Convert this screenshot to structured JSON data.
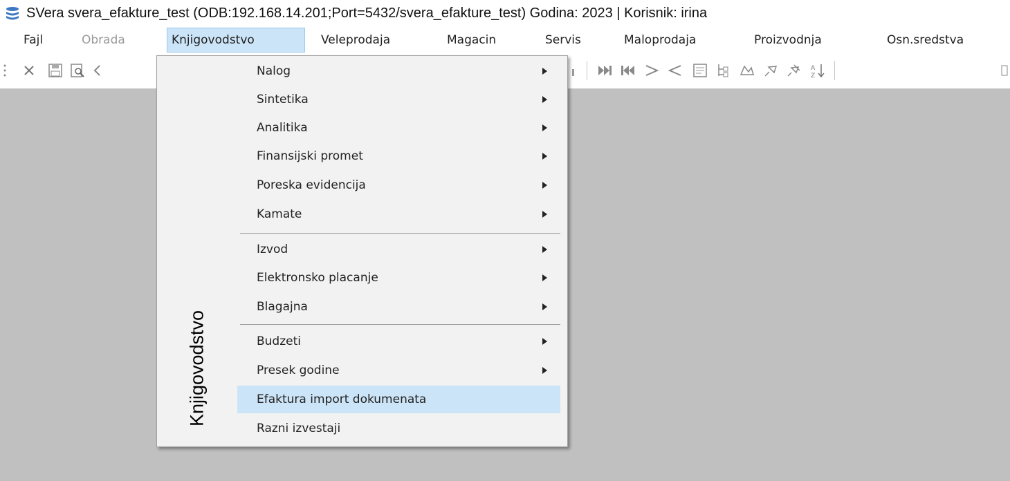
{
  "window": {
    "title": "SVera svera_efakture_test  (ODB:192.168.14.201;Port=5432/svera_efakture_test)  Godina: 2023 | Korisnik: irina"
  },
  "menubar": {
    "items": [
      {
        "label": "Fajl"
      },
      {
        "label": "Obrada"
      },
      {
        "label": "Knjigovodstvo"
      },
      {
        "label": "Veleprodaja"
      },
      {
        "label": "Magacin"
      },
      {
        "label": "Servis"
      },
      {
        "label": "Maloprodaja"
      },
      {
        "label": "Proizvodnja"
      },
      {
        "label": "Osn.sredstva"
      }
    ]
  },
  "toolbar": {
    "icons": [
      "grip-icon",
      "close-icon",
      "save-icon",
      "print-preview-icon",
      "back-icon",
      "chart-icon",
      "last-record-icon",
      "first-record-icon",
      "greater-icon",
      "less-icon",
      "document-icon",
      "tree-icon",
      "image-icon",
      "pin-icon",
      "multi-pin-icon",
      "sort-az-icon",
      "more-icon"
    ]
  },
  "dropdown": {
    "side_label": "Knjigovodstvo",
    "items": [
      {
        "label": "Nalog",
        "submenu": true
      },
      {
        "label": "Sintetika",
        "submenu": true
      },
      {
        "label": "Analitika",
        "submenu": true
      },
      {
        "label": "Finansijski promet",
        "submenu": true
      },
      {
        "label": "Poreska evidencija",
        "submenu": true
      },
      {
        "label": "Kamate",
        "submenu": true
      },
      {
        "label": "Izvod",
        "submenu": true
      },
      {
        "label": "Elektronsko placanje",
        "submenu": true
      },
      {
        "label": "Blagajna",
        "submenu": true
      },
      {
        "label": "Budzeti",
        "submenu": true
      },
      {
        "label": "Presek godine",
        "submenu": true
      },
      {
        "label": "Efaktura import dokumenata",
        "submenu": false,
        "highlighted": true
      },
      {
        "label": "Razni izvestaji",
        "submenu": false
      }
    ]
  },
  "colors": {
    "workspace": "#c0c0c0",
    "menu_highlight": "#cce4f7",
    "dropdown_bg": "#f2f2f2"
  }
}
